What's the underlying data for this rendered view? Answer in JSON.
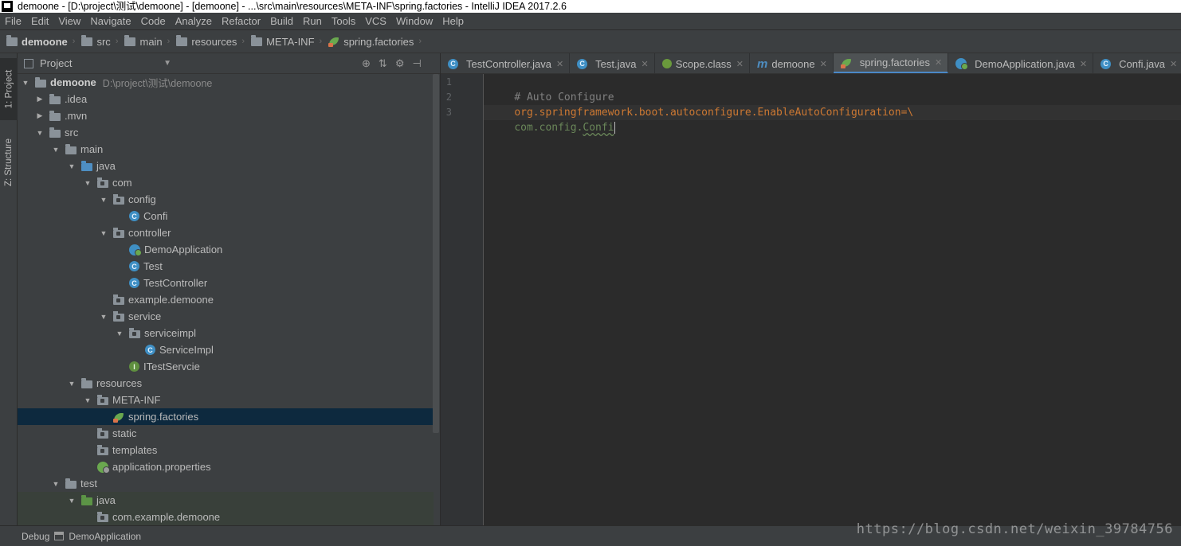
{
  "window": {
    "title": "demoone - [D:\\project\\测试\\demoone] - [demoone] - ...\\src\\main\\resources\\META-INF\\spring.factories - IntelliJ IDEA 2017.2.6"
  },
  "menu": [
    "File",
    "Edit",
    "View",
    "Navigate",
    "Code",
    "Analyze",
    "Refactor",
    "Build",
    "Run",
    "Tools",
    "VCS",
    "Window",
    "Help"
  ],
  "breadcrumb": [
    {
      "label": "demoone",
      "icon": "module-folder-icon"
    },
    {
      "label": "src",
      "icon": "folder-icon"
    },
    {
      "label": "main",
      "icon": "folder-icon"
    },
    {
      "label": "resources",
      "icon": "folder-icon"
    },
    {
      "label": "META-INF",
      "icon": "folder-icon"
    },
    {
      "label": "spring.factories",
      "icon": "spring-file-icon"
    }
  ],
  "left_strip": {
    "project_tab": "1: Project",
    "structure_tab": "Z: Structure"
  },
  "project_panel": {
    "title": "Project",
    "tree": [
      {
        "label": "demoone",
        "path": "D:\\project\\测试\\demoone"
      },
      {
        "label": ".idea"
      },
      {
        "label": ".mvn"
      },
      {
        "label": "src"
      },
      {
        "label": "main"
      },
      {
        "label": "java"
      },
      {
        "label": "com"
      },
      {
        "label": "config"
      },
      {
        "label": "Confi",
        "icon": "class-icon"
      },
      {
        "label": "controller"
      },
      {
        "label": "DemoApplication",
        "icon": "spring-boot-app-icon"
      },
      {
        "label": "Test",
        "icon": "class-icon"
      },
      {
        "label": "TestController",
        "icon": "class-icon"
      },
      {
        "label": "example.demoone"
      },
      {
        "label": "service"
      },
      {
        "label": "serviceimpl"
      },
      {
        "label": "ServiceImpl",
        "icon": "class-icon"
      },
      {
        "label": "ITestServcie",
        "icon": "interface-icon"
      },
      {
        "label": "resources"
      },
      {
        "label": "META-INF"
      },
      {
        "label": "spring.factories",
        "icon": "spring-file-icon",
        "selected": true
      },
      {
        "label": "static"
      },
      {
        "label": "templates"
      },
      {
        "label": "application.properties",
        "icon": "spring-properties-icon"
      },
      {
        "label": "test"
      },
      {
        "label": "java"
      },
      {
        "label": "com.example.demoone"
      }
    ]
  },
  "editor_tabs": [
    {
      "label": "TestController.java",
      "icon": "class-icon"
    },
    {
      "label": "Test.java",
      "icon": "class-icon"
    },
    {
      "label": "Scope.class",
      "icon": "annotation-icon"
    },
    {
      "label": "demoone",
      "icon": "maven-icon"
    },
    {
      "label": "spring.factories",
      "icon": "spring-file-icon",
      "active": true
    },
    {
      "label": "DemoApplication.java",
      "icon": "spring-boot-app-icon"
    },
    {
      "label": "Confi.java",
      "icon": "class-icon"
    }
  ],
  "editor": {
    "line_numbers": [
      "1",
      "2",
      "3"
    ],
    "lines": [
      {
        "comment": "# Auto Configure"
      },
      {
        "key": "org.springframework.boot.autoconfigure.EnableAutoConfiguration",
        "sep": "=\\"
      },
      {
        "value_prefix": "com.config.",
        "value_ref": "Confi"
      }
    ]
  },
  "statusbar": {
    "debug_label": "Debug",
    "run_config": "DemoApplication"
  },
  "watermark": "https://blog.csdn.net/weixin_39784756",
  "colors": {
    "background": "#3c3f41",
    "editor_bg": "#2b2b2b",
    "selection": "#0d293e",
    "keyword_orange": "#cc7832",
    "string_green": "#6a8759",
    "comment_gray": "#808080",
    "class_blue": "#3f8fc4"
  }
}
